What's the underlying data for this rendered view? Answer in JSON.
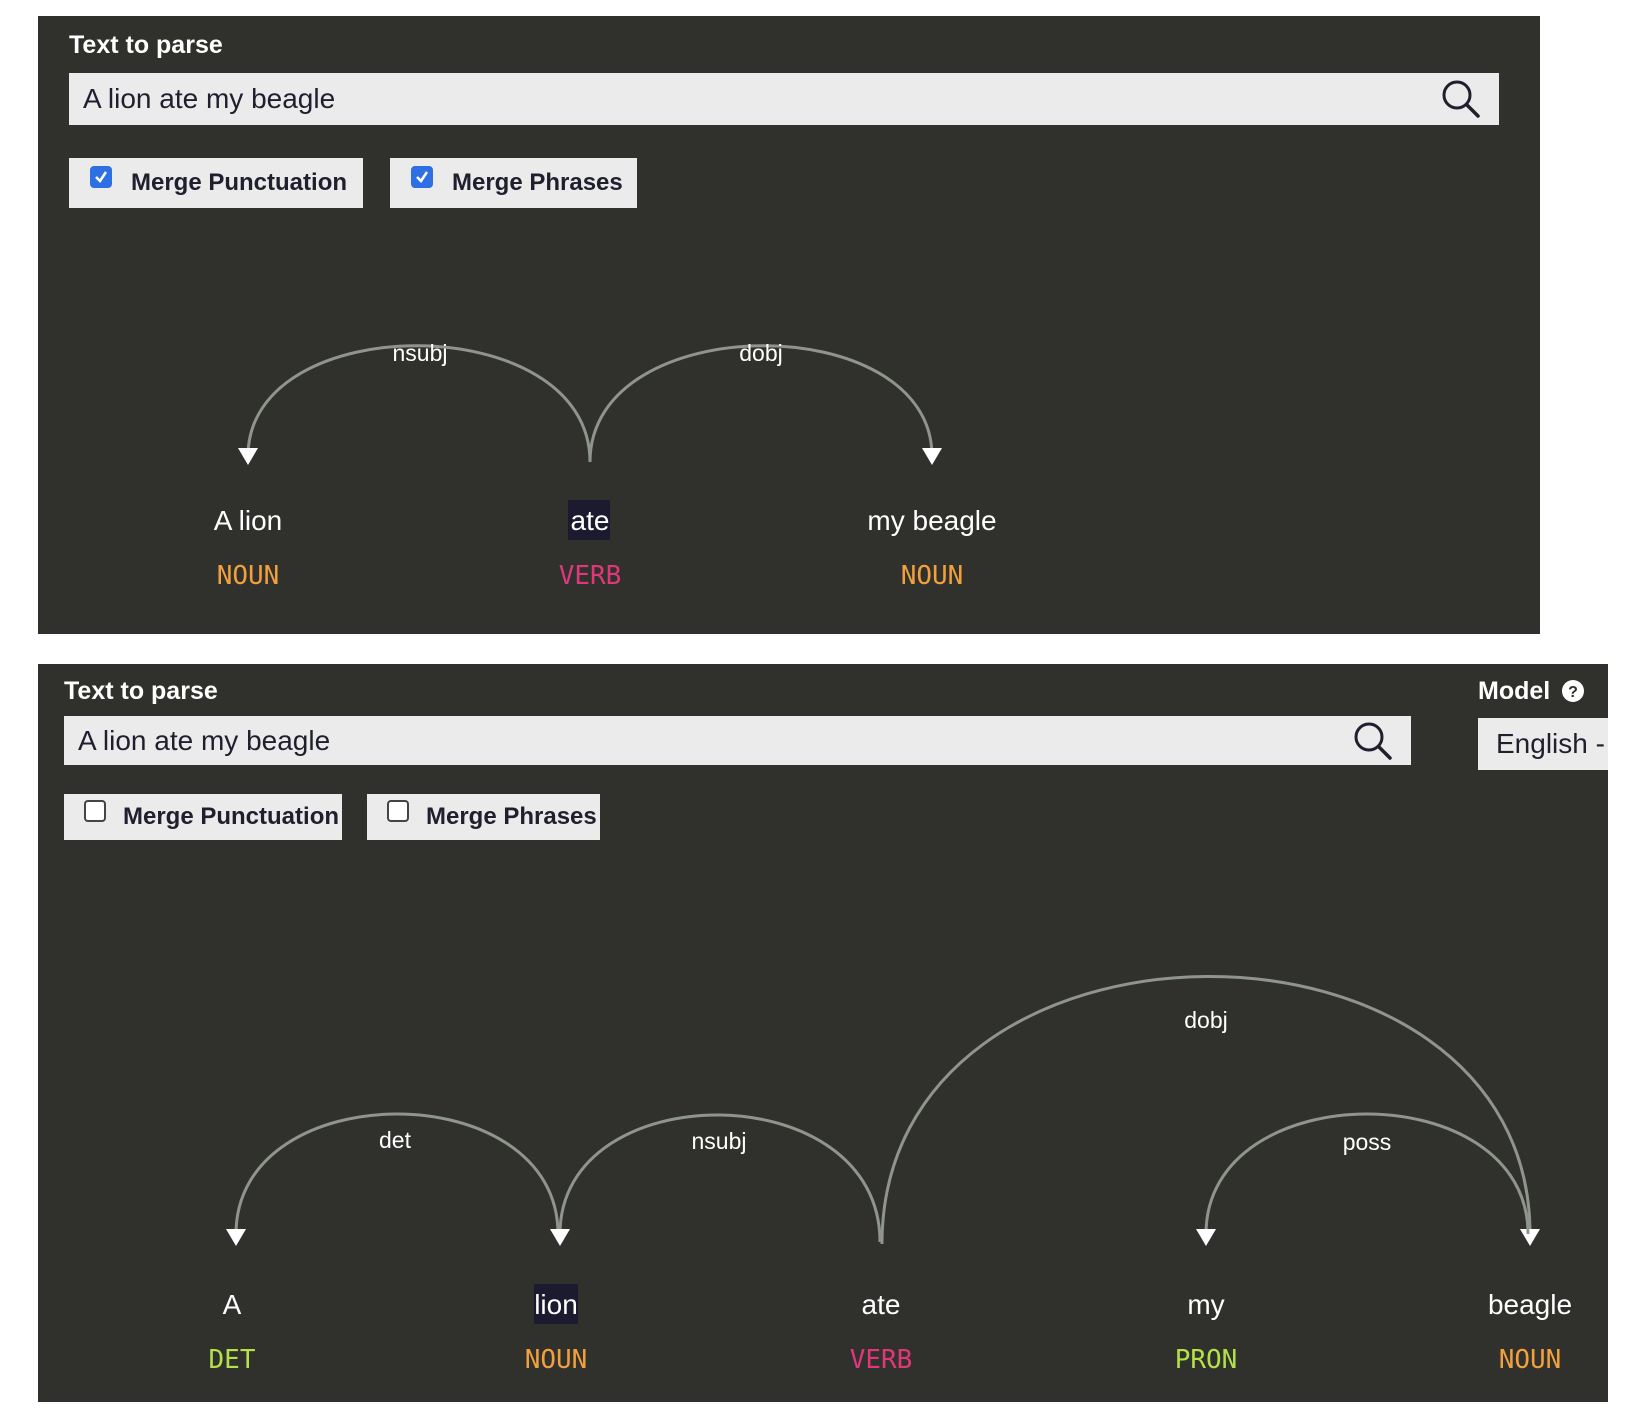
{
  "panel1": {
    "title": "Text to parse",
    "query": "A lion ate my beagle",
    "merge_punct": {
      "label": "Merge Punctuation",
      "checked": true
    },
    "merge_phrases": {
      "label": "Merge Phrases",
      "checked": true
    },
    "tokens": [
      {
        "text": "A lion",
        "tag": "NOUN"
      },
      {
        "text": "ate",
        "tag": "VERB"
      },
      {
        "text": "my beagle",
        "tag": "NOUN"
      }
    ],
    "arcs": [
      {
        "label": "nsubj",
        "from": 1,
        "to": 0
      },
      {
        "label": "dobj",
        "from": 1,
        "to": 2
      }
    ]
  },
  "panel2": {
    "title": "Text to parse",
    "query": "A lion ate my beagle",
    "merge_punct": {
      "label": "Merge Punctuation",
      "checked": false
    },
    "merge_phrases": {
      "label": "Merge Phrases",
      "checked": false
    },
    "model": {
      "label": "Model",
      "value": "English -"
    },
    "tokens": [
      {
        "text": "A",
        "tag": "DET"
      },
      {
        "text": "lion",
        "tag": "NOUN"
      },
      {
        "text": "ate",
        "tag": "VERB"
      },
      {
        "text": "my",
        "tag": "PRON"
      },
      {
        "text": "beagle",
        "tag": "NOUN"
      }
    ],
    "arcs": [
      {
        "label": "det",
        "from": 1,
        "to": 0
      },
      {
        "label": "nsubj",
        "from": 2,
        "to": 1
      },
      {
        "label": "dobj",
        "from": 2,
        "to": 4
      },
      {
        "label": "poss",
        "from": 4,
        "to": 3
      }
    ]
  },
  "colors": {
    "panel_bg": "#30312d",
    "NOUN": "#f2a03d",
    "VERB": "#e0367a",
    "DET": "#b5e048",
    "PRON": "#b5e048",
    "arc": "#8f948d",
    "highlight": "#1c1a2e"
  },
  "icons": {
    "search": "search-icon",
    "help": "question-circle-icon",
    "check": "checkmark-icon"
  }
}
